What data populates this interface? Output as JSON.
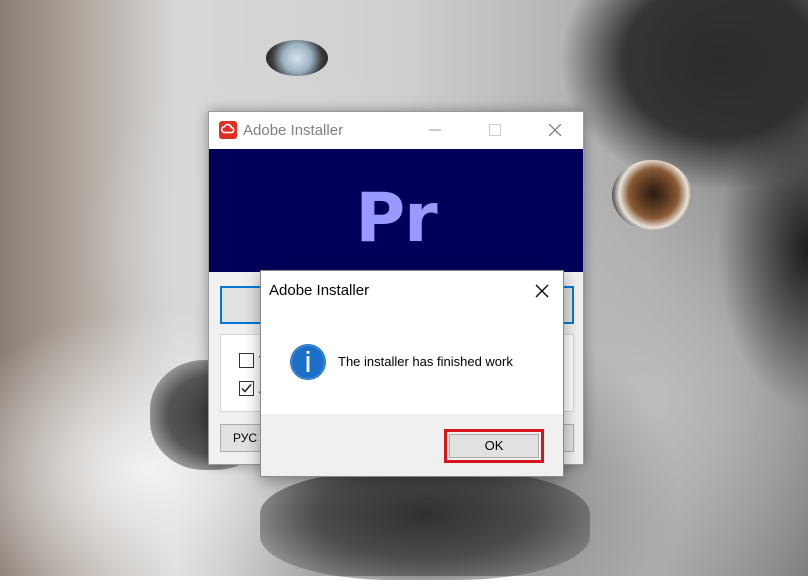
{
  "installer": {
    "title": "Adobe Installer",
    "banner_text": "Pr",
    "option1_label": "V",
    "option2_label": "A",
    "option1_checked": false,
    "option2_checked": true,
    "language_button": "РУС",
    "icon": "adobe-creative-cloud-icon",
    "banner_color": "#00005b",
    "banner_text_color": "#9999ff"
  },
  "dialog": {
    "title": "Adobe Installer",
    "message": "The installer has finished work",
    "icon": "info-icon",
    "ok_label": "OK",
    "highlight_color": "#d7141a"
  }
}
